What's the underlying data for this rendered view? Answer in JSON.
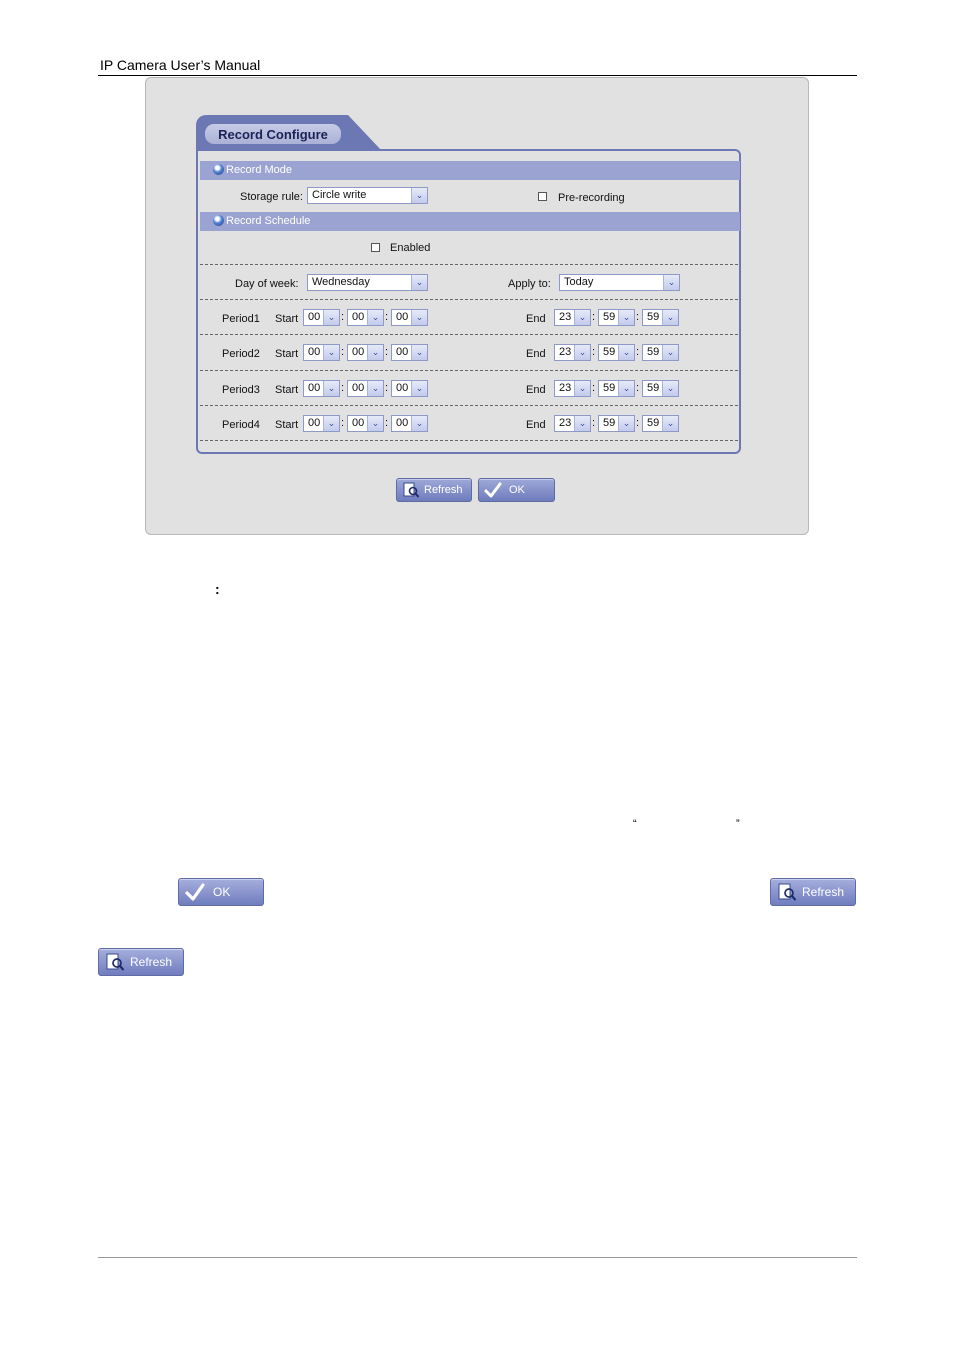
{
  "doc": {
    "header_title": "IP Camera User’s Manual"
  },
  "ui": {
    "tab_title": "Record Configure",
    "record_mode": {
      "section_label": "Record Mode",
      "storage_rule_label": "Storage rule:",
      "storage_rule_value": "Circle write",
      "pre_recording_label": "Pre-recording"
    },
    "record_schedule": {
      "section_label": "Record Schedule",
      "enabled_label": "Enabled",
      "day_of_week_label": "Day of week:",
      "day_of_week_value": "Wednesday",
      "apply_to_label": "Apply to:",
      "apply_to_value": "Today",
      "start_label": "Start",
      "end_label": "End",
      "periods": [
        {
          "label": "Period1",
          "start_h": "00",
          "start_m": "00",
          "start_s": "00",
          "end_h": "23",
          "end_m": "59",
          "end_s": "59"
        },
        {
          "label": "Period2",
          "start_h": "00",
          "start_m": "00",
          "start_s": "00",
          "end_h": "23",
          "end_m": "59",
          "end_s": "59"
        },
        {
          "label": "Period3",
          "start_h": "00",
          "start_m": "00",
          "start_s": "00",
          "end_h": "23",
          "end_m": "59",
          "end_s": "59"
        },
        {
          "label": "Period4",
          "start_h": "00",
          "start_m": "00",
          "start_s": "00",
          "end_h": "23",
          "end_m": "59",
          "end_s": "59"
        }
      ]
    },
    "refresh_label": "Refresh",
    "ok_label": "OK"
  },
  "body_text": {
    "colon_char": ":",
    "open_quote": "“",
    "close_quote": "”"
  },
  "colors": {
    "accent": "#6c78b4",
    "section_bar": "#9aa3d2",
    "panel_bg": "#e1e1e1"
  }
}
